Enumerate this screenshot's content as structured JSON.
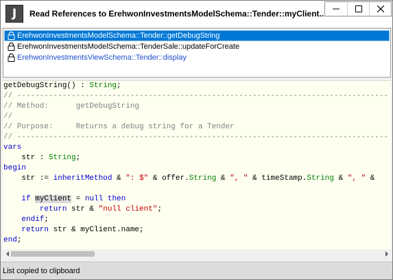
{
  "window": {
    "title": "Read References to ErehwonInvestmentsModelSchema::Tender::myClient...",
    "app_icon_letter": "J",
    "buttons": {
      "minimize": "minimize-icon",
      "maximize": "maximize-icon",
      "close": "close-icon"
    }
  },
  "references": [
    {
      "text": "ErehwonInvestmentsModelSchema::Tender::getDebugString",
      "icon": "lock-icon",
      "selected": true
    },
    {
      "text": "ErehwonInvestmentsModelSchema::TenderSale::updateForCreate",
      "icon": "lock-icon",
      "selected": false
    },
    {
      "text": "ErehwonInvestmentsViewSchema::Tender::display",
      "icon": "lock-icon",
      "selected": false
    }
  ],
  "code": {
    "l1_name": "getDebugString() : ",
    "l1_type": "String",
    "l1_end": ";",
    "l2": "// ----------------------------------------------------------------------------------",
    "l3": "// Method:      getDebugString",
    "l4": "//",
    "l5": "// Purpose:     Returns a debug string for a Tender",
    "l6": "// ----------------------------------------------------------------------------------",
    "l7_kw": "vars",
    "l8_pre": "    str : ",
    "l8_type": "String",
    "l8_end": ";",
    "l9_kw": "begin",
    "l10_a": "    str := ",
    "l10_kw": "inheritMethod",
    "l10_b": " & ",
    "l10_s1": "\": $\"",
    "l10_c": " & offer.",
    "l10_t1": "String",
    "l10_d": " & ",
    "l10_s2": "\", \"",
    "l10_e": " & timeStamp.",
    "l10_t2": "String",
    "l10_f": " & ",
    "l10_s3": "\", \"",
    "l10_g": " &",
    "l12_pre": "    ",
    "l12_if": "if",
    "l12_sp": " ",
    "l12_var": "myClient",
    "l12_eq": " = ",
    "l12_null": "null",
    "l12_sp2": " ",
    "l12_then": "then",
    "l13_pre": "        ",
    "l13_kw": "return",
    "l13_mid": " str & ",
    "l13_str": "\"null client\"",
    "l13_end": ";",
    "l14_pre": "    ",
    "l14_kw": "endif",
    "l14_end": ";",
    "l15_pre": "    ",
    "l15_kw": "return",
    "l15_rest": " str & myClient.name;",
    "l16_kw": "end",
    "l16_end": ";"
  },
  "status": {
    "text": "List copied to clipboard"
  },
  "colors": {
    "selection": "#0078d7",
    "keyword": "#0000d0",
    "type": "#008000",
    "comment": "#808080",
    "string": "#c00000",
    "code_background": "#fffff0"
  }
}
